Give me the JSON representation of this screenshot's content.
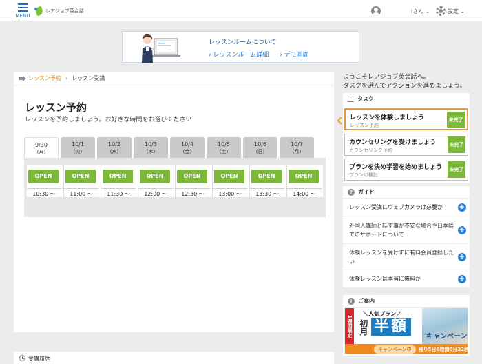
{
  "header": {
    "menu_label": "MENU",
    "logo_text": "レアジョブ英会話",
    "user_name": "iさん ⌄",
    "settings_label": "設定 ⌄"
  },
  "banner": {
    "title": "レッスンルームについて",
    "link1": "レッスンルーム詳細",
    "link2": "デモ画面"
  },
  "breadcrumb": {
    "link": "レッスン予約",
    "current": "レッスン受講"
  },
  "main": {
    "title": "レッスン予約",
    "description": "レッスンを予約しましょう。お好きな時間をお選びください"
  },
  "date_tabs": [
    {
      "date": "9/30",
      "dow": "(月)"
    },
    {
      "date": "10/1",
      "dow": "(火)"
    },
    {
      "date": "10/2",
      "dow": "(水)"
    },
    {
      "date": "10/3",
      "dow": "(木)"
    },
    {
      "date": "10/4",
      "dow": "(金)"
    },
    {
      "date": "10/5",
      "dow": "(土)"
    },
    {
      "date": "10/6",
      "dow": "(日)"
    },
    {
      "date": "10/7",
      "dow": "(月)"
    }
  ],
  "slots": [
    {
      "label": "OPEN",
      "time": "10:30 〜"
    },
    {
      "label": "OPEN",
      "time": "11:00 〜"
    },
    {
      "label": "OPEN",
      "time": "11:30 〜"
    },
    {
      "label": "OPEN",
      "time": "12:00 〜"
    },
    {
      "label": "OPEN",
      "time": "12:30 〜"
    },
    {
      "label": "OPEN",
      "time": "13:00 〜"
    },
    {
      "label": "OPEN",
      "time": "13:30 〜"
    },
    {
      "label": "OPEN",
      "time": "14:00 〜"
    }
  ],
  "history": {
    "title": "受講履歴"
  },
  "welcome": {
    "line1": "ようこそレアジョブ英会話へ。",
    "line2": "タスクを選んでアクションを進めましょう。"
  },
  "tasks": {
    "title": "タスク",
    "items": [
      {
        "title": "レッスンを体験しましょう",
        "sub": "レッスン予約",
        "status": "未完了"
      },
      {
        "title": "カウンセリングを受けましょう",
        "sub": "カウンセリング予約",
        "status": "未完了"
      },
      {
        "title": "プランを決め学習を始めましょう",
        "sub": "プランの検討",
        "status": "未完了"
      }
    ]
  },
  "guide": {
    "title": "ガイド",
    "items": [
      "レッスン受講にウェブカメラは必要か",
      "外国人講師と話す事が不安な場合や日本語でのサポートについて",
      "体験レッスンを受けずに有料会員登録したい",
      "体験レッスンは本当に無料か"
    ]
  },
  "info": {
    "title": "ご案内",
    "promo_red": "1週間限定",
    "promo_tag": "＼人気プラン／",
    "promo_big1": "初月",
    "promo_big2": "半額",
    "promo_word": "キャンペーン",
    "promo_pill": "キャンペーン中",
    "promo_count": "残り5日6時間0分22秒"
  },
  "colors": {
    "accent_green": "#7cb83a",
    "accent_orange": "#e89a3c",
    "link_blue": "#1f77d0"
  }
}
